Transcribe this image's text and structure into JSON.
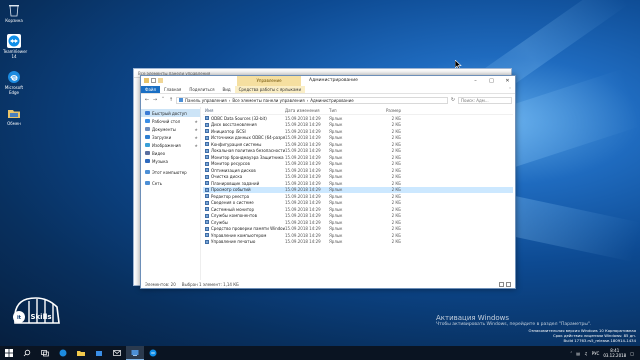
{
  "desktop": {
    "icons": [
      {
        "label": "Корзина",
        "icon": "recycle-bin-icon"
      },
      {
        "label": "TeamViewer 14",
        "icon": "teamviewer-icon"
      },
      {
        "label": "Microsoft Edge",
        "icon": "edge-icon"
      },
      {
        "label": "Обмен",
        "icon": "folder-icon"
      }
    ]
  },
  "back_window": {
    "title": "Все элементы панели управления"
  },
  "window": {
    "title": "Администрирование",
    "context_group": "Управление",
    "ribbon_tabs": [
      {
        "label": "Файл"
      },
      {
        "label": "Главная"
      },
      {
        "label": "Поделиться"
      },
      {
        "label": "Вид"
      },
      {
        "label": "Средства работы с ярлыками"
      }
    ],
    "address": [
      "Панель управления",
      "Все элементы панели управления",
      "Администрирование"
    ],
    "search_placeholder": "Поиск: Адм...",
    "columns": [
      "Имя",
      "Дата изменения",
      "Тип",
      "Размер"
    ],
    "nav": [
      {
        "label": "Быстрый доступ",
        "icon": "star-icon",
        "color": "#3a7bd5"
      },
      {
        "label": "Рабочий стол",
        "icon": "desktop-icon",
        "color": "#3a8ee6"
      },
      {
        "label": "Документы",
        "icon": "documents-icon",
        "color": "#6a8cbf"
      },
      {
        "label": "Загрузки",
        "icon": "downloads-icon",
        "color": "#2f7fd1"
      },
      {
        "label": "Изображения",
        "icon": "pictures-icon",
        "color": "#3aa0d8"
      },
      {
        "label": "Видео",
        "icon": "video-icon",
        "color": "#5a6fa0"
      },
      {
        "label": "Музыка",
        "icon": "music-icon",
        "color": "#2f6bbf"
      },
      {
        "label": "Этот компьютер",
        "icon": "computer-icon",
        "color": "#4c8fd6"
      },
      {
        "label": "Сеть",
        "icon": "network-icon",
        "color": "#4c8fd6"
      }
    ],
    "files": [
      {
        "name": "ODBC Data Sources (32-bit)",
        "date": "15.09.2018 14:29",
        "type": "Ярлык",
        "size": "2 КБ"
      },
      {
        "name": "Диск восстановления",
        "date": "15.09.2018 14:29",
        "type": "Ярлык",
        "size": "2 КБ"
      },
      {
        "name": "Инициатор iSCSI",
        "date": "15.09.2018 14:29",
        "type": "Ярлык",
        "size": "2 КБ"
      },
      {
        "name": "Источники данных ODBC (64-разряд...",
        "date": "15.09.2018 14:29",
        "type": "Ярлык",
        "size": "2 КБ"
      },
      {
        "name": "Конфигурация системы",
        "date": "15.09.2018 14:29",
        "type": "Ярлык",
        "size": "2 КБ"
      },
      {
        "name": "Локальная политика безопасности",
        "date": "15.09.2018 14:29",
        "type": "Ярлык",
        "size": "2 КБ"
      },
      {
        "name": "Монитор брандмауэра Защитника W...",
        "date": "15.09.2018 14:29",
        "type": "Ярлык",
        "size": "2 КБ"
      },
      {
        "name": "Монитор ресурсов",
        "date": "15.09.2018 14:29",
        "type": "Ярлык",
        "size": "2 КБ"
      },
      {
        "name": "Оптимизация дисков",
        "date": "15.09.2018 14:29",
        "type": "Ярлык",
        "size": "2 КБ"
      },
      {
        "name": "Очистка диска",
        "date": "15.09.2018 14:29",
        "type": "Ярлык",
        "size": "2 КБ"
      },
      {
        "name": "Планировщик заданий",
        "date": "15.09.2018 14:29",
        "type": "Ярлык",
        "size": "2 КБ"
      },
      {
        "name": "Просмотр событий",
        "date": "15.09.2018 14:29",
        "type": "Ярлык",
        "size": "2 КБ",
        "selected": true
      },
      {
        "name": "Редактор реестра",
        "date": "15.09.2018 14:29",
        "type": "Ярлык",
        "size": "2 КБ"
      },
      {
        "name": "Сведения о системе",
        "date": "15.09.2018 14:29",
        "type": "Ярлык",
        "size": "2 КБ"
      },
      {
        "name": "Системный монитор",
        "date": "15.09.2018 14:29",
        "type": "Ярлык",
        "size": "2 КБ"
      },
      {
        "name": "Службы компонентов",
        "date": "15.09.2018 14:29",
        "type": "Ярлык",
        "size": "2 КБ"
      },
      {
        "name": "Службы",
        "date": "15.09.2018 14:29",
        "type": "Ярлык",
        "size": "2 КБ"
      },
      {
        "name": "Средство проверки памяти Windows",
        "date": "15.09.2018 14:29",
        "type": "Ярлык",
        "size": "2 КБ"
      },
      {
        "name": "Управление компьютером",
        "date": "15.09.2018 14:29",
        "type": "Ярлык",
        "size": "2 КБ"
      },
      {
        "name": "Управление печатью",
        "date": "15.09.2018 14:29",
        "type": "Ярлык",
        "size": "2 КБ"
      }
    ],
    "status": {
      "count": "Элементов: 20",
      "selected": "Выбран 1 элемент: 1,14 КБ"
    }
  },
  "activation": {
    "title": "Активация Windows",
    "subtitle": "Чтобы активировать Windows, перейдите в раздел \"Параметры\"."
  },
  "build": {
    "line1": "Ознакомительная версия Windows 10 Корпоративная",
    "line2": "Срок действия лицензии Windows: 85 дн.",
    "line3": "Build 17763.rs5_release.180914-1434"
  },
  "brand": {
    "text": "IT SKILLS"
  },
  "taskbar": {
    "items": [
      "start-icon",
      "search-icon",
      "task-view-icon",
      "edge-icon",
      "explorer-icon",
      "store-icon",
      "mail-icon",
      "control-panel-icon",
      "teamviewer-icon"
    ],
    "active_index": 7,
    "lang": "РУС",
    "time": "8:41",
    "date": "03.12.2018"
  },
  "colors": {
    "accent": "#1a6fc4",
    "selection": "#cce8ff",
    "ctx": "#f5dfa0"
  }
}
